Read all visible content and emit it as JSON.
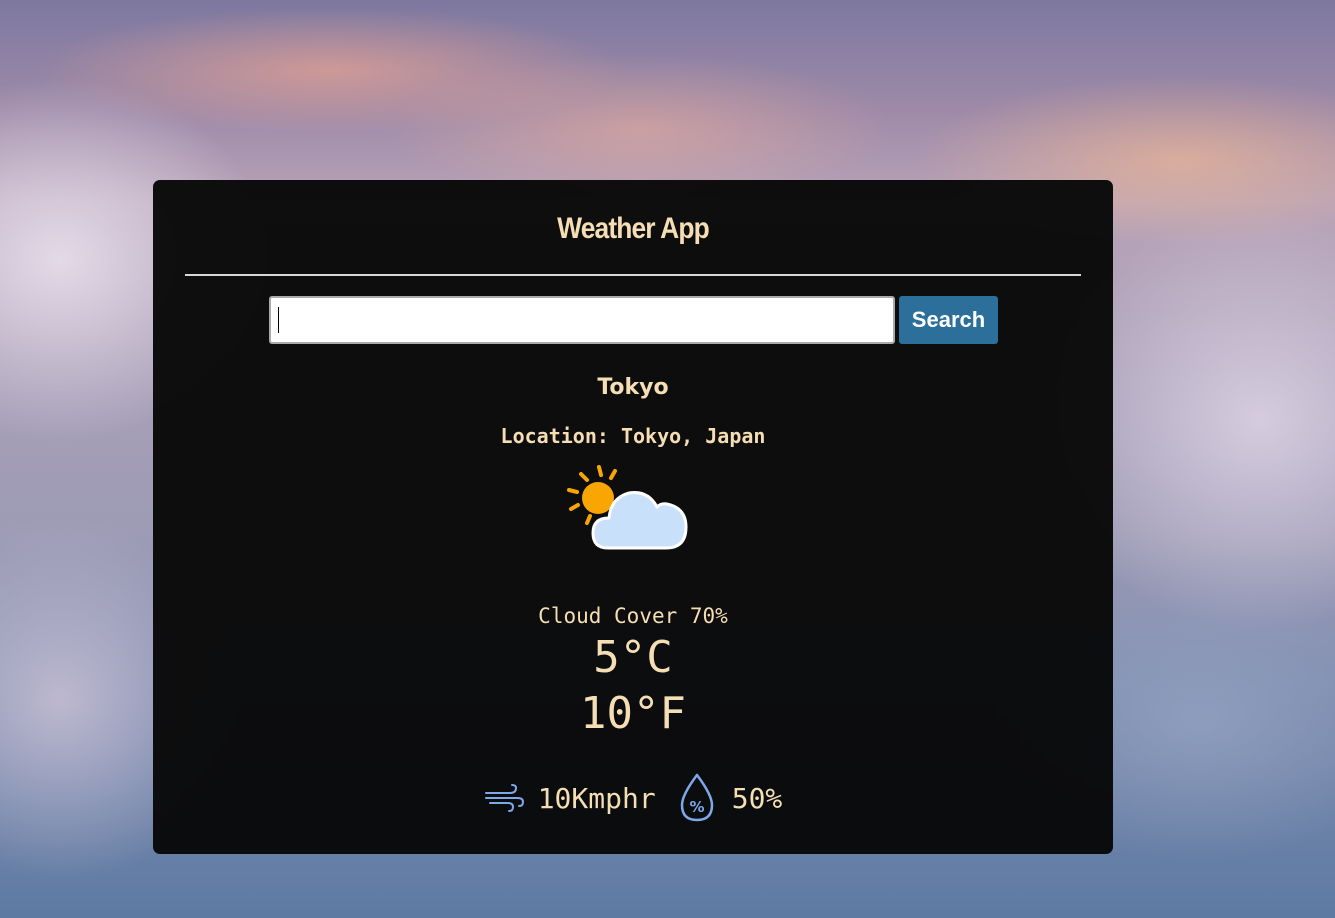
{
  "app": {
    "title": "Weather App"
  },
  "search": {
    "value": "",
    "button_label": "Search"
  },
  "weather": {
    "city": "Tokyo",
    "location": "Location: Tokyo, Japan",
    "condition_icon": "partly-cloudy-icon",
    "cloud_cover": "Cloud Cover 70%",
    "temp_c": "5°C",
    "temp_f": "10°F",
    "wind": "10Kmphr",
    "humidity": "50%"
  },
  "colors": {
    "card_bg": "#070707",
    "text": "#f5deb3",
    "button": "#2b6f9a",
    "sun": "#f9a602",
    "cloud": "#c9e0fb",
    "stat_icon": "#7fa8e8"
  }
}
